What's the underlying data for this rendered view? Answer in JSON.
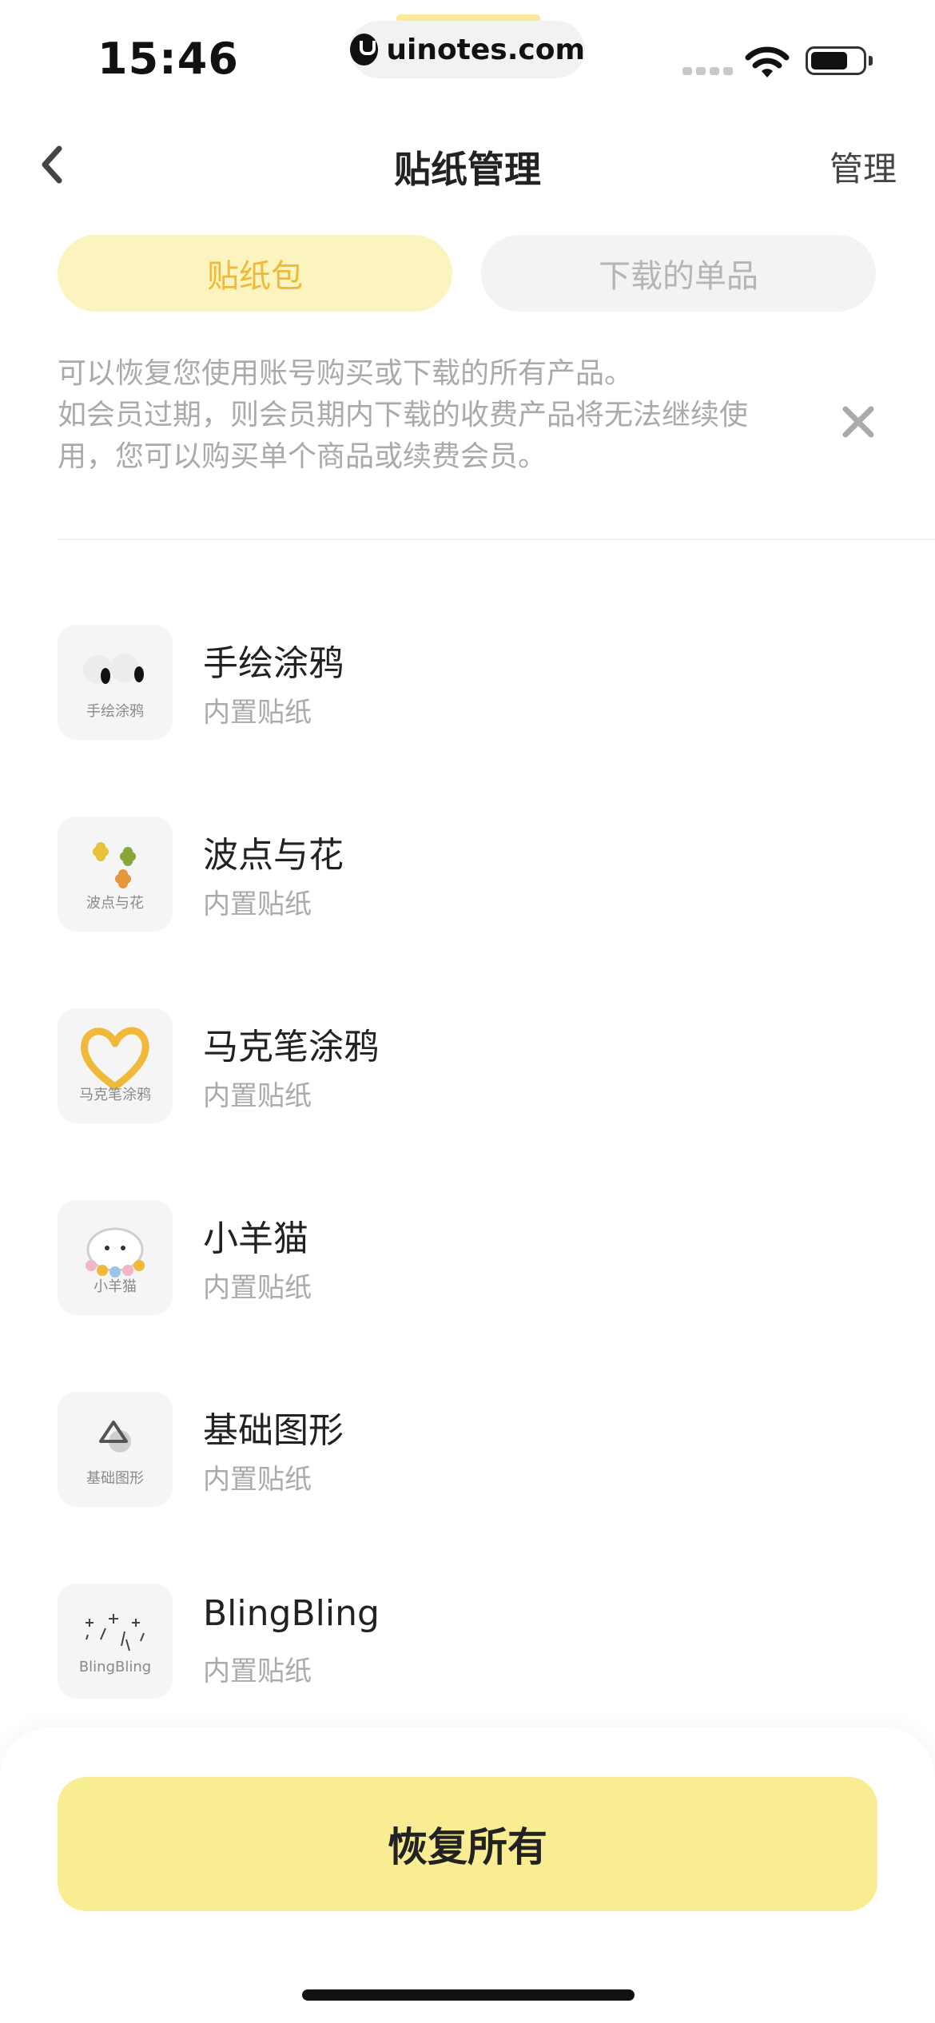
{
  "status_bar": {
    "time": "15:46",
    "url": "uinotes.com"
  },
  "nav": {
    "title": "贴纸管理",
    "manage_label": "管理"
  },
  "tabs": [
    {
      "label": "贴纸包",
      "active": true
    },
    {
      "label": "下载的单品",
      "active": false
    }
  ],
  "notice": {
    "line1": "可以恢复您使用账号购买或下载的所有产品。",
    "line2": "如会员过期，则会员期内下载的收费产品将无法继续使用，您可以购买单个商品或续费会员。"
  },
  "stickers": [
    {
      "title": "手绘涂鸦",
      "subtitle": "内置贴纸",
      "thumb_label": "手绘涂鸦"
    },
    {
      "title": "波点与花",
      "subtitle": "内置贴纸",
      "thumb_label": "波点与花"
    },
    {
      "title": "马克笔涂鸦",
      "subtitle": "内置贴纸",
      "thumb_label": "马克笔涂鸦"
    },
    {
      "title": "小羊猫",
      "subtitle": "内置贴纸",
      "thumb_label": "小羊猫"
    },
    {
      "title": "基础图形",
      "subtitle": "内置贴纸",
      "thumb_label": "基础图形"
    },
    {
      "title": "BlingBling",
      "subtitle": "内置贴纸",
      "thumb_label": "BlingBling"
    }
  ],
  "restore_button": {
    "label": "恢复所有"
  },
  "colors": {
    "accent": "#f0b93a",
    "button": "#f9ed94",
    "tab_active_bg": "#fcf4be"
  }
}
